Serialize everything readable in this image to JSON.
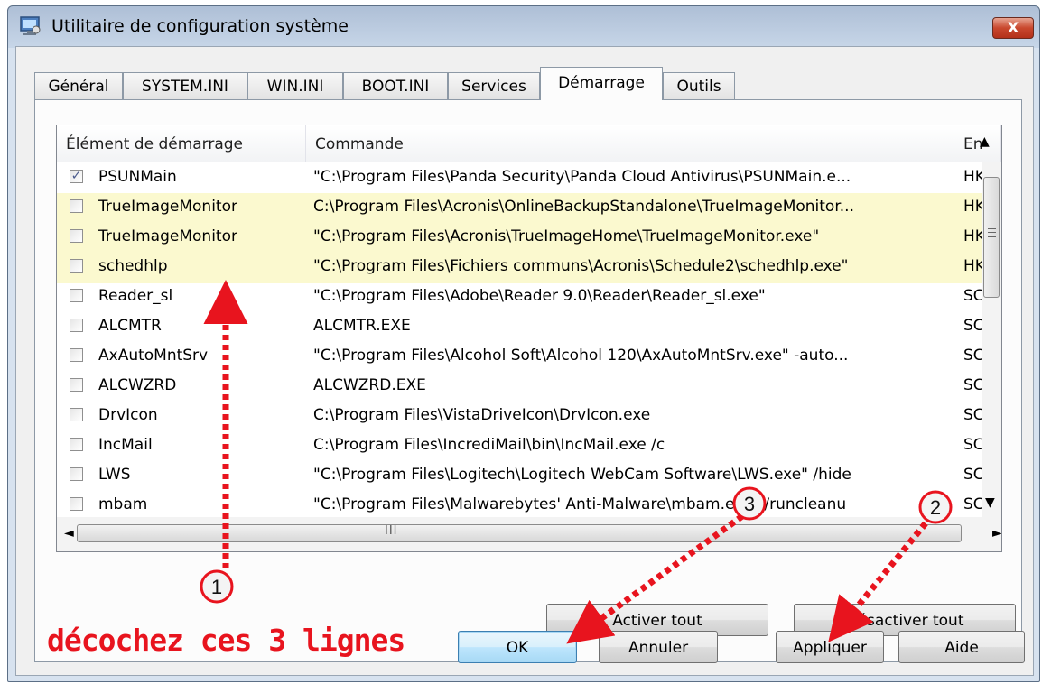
{
  "window": {
    "title": "Utilitaire de configuration système",
    "close_label": "X"
  },
  "tabs": [
    {
      "label": "Général"
    },
    {
      "label": "SYSTEM.INI"
    },
    {
      "label": "WIN.INI"
    },
    {
      "label": "BOOT.INI"
    },
    {
      "label": "Services"
    },
    {
      "label": "Démarrage",
      "active": true
    },
    {
      "label": "Outils"
    }
  ],
  "list": {
    "columns": [
      "Élément de démarrage",
      "Commande",
      "En"
    ],
    "rows": [
      {
        "name": "PSUNMain",
        "command": "\"C:\\Program Files\\Panda Security\\Panda Cloud Antivirus\\PSUNMain.e...",
        "location": "HK",
        "checked": true,
        "highlight": false
      },
      {
        "name": "TrueImageMonitor",
        "command": "C:\\Program Files\\Acronis\\OnlineBackupStandalone\\TrueImageMonitor...",
        "location": "HK",
        "checked": false,
        "highlight": true
      },
      {
        "name": "TrueImageMonitor",
        "command": "\"C:\\Program Files\\Acronis\\TrueImageHome\\TrueImageMonitor.exe\"",
        "location": "HK",
        "checked": false,
        "highlight": true
      },
      {
        "name": "schedhlp",
        "command": "\"C:\\Program Files\\Fichiers communs\\Acronis\\Schedule2\\schedhlp.exe\"",
        "location": "HK",
        "checked": false,
        "highlight": true
      },
      {
        "name": "Reader_sl",
        "command": "\"C:\\Program Files\\Adobe\\Reader 9.0\\Reader\\Reader_sl.exe\"",
        "location": "SC",
        "checked": false,
        "highlight": false
      },
      {
        "name": "ALCMTR",
        "command": "ALCMTR.EXE",
        "location": "SC",
        "checked": false,
        "highlight": false
      },
      {
        "name": "AxAutoMntSrv",
        "command": "\"C:\\Program Files\\Alcohol Soft\\Alcohol 120\\AxAutoMntSrv.exe\" -auto...",
        "location": "SC",
        "checked": false,
        "highlight": false
      },
      {
        "name": "ALCWZRD",
        "command": "ALCWZRD.EXE",
        "location": "SC",
        "checked": false,
        "highlight": false
      },
      {
        "name": "DrvIcon",
        "command": "C:\\Program Files\\VistaDriveIcon\\DrvIcon.exe",
        "location": "SC",
        "checked": false,
        "highlight": false
      },
      {
        "name": "IncMail",
        "command": "C:\\Program Files\\IncrediMail\\bin\\IncMail.exe /c",
        "location": "SC",
        "checked": false,
        "highlight": false
      },
      {
        "name": "LWS",
        "command": "\"C:\\Program Files\\Logitech\\Logitech WebCam Software\\LWS.exe\" /hide",
        "location": "SC",
        "checked": false,
        "highlight": false
      },
      {
        "name": "mbam",
        "command": "\"C:\\Program Files\\Malwarebytes' Anti-Malware\\mbam.exe\" /runcleanu",
        "location": "SC",
        "checked": false,
        "highlight": false
      }
    ],
    "hscroll_grip": "III"
  },
  "buttons": {
    "enable_all": "Activer tout",
    "disable_all": "Désactiver tout",
    "ok": "OK",
    "cancel": "Annuler",
    "apply": "Appliquer",
    "help": "Aide"
  },
  "annotations": {
    "note": "décochez ces 3 lignes",
    "markers": [
      "1",
      "2",
      "3"
    ],
    "color": "#e8141e"
  },
  "colors": {
    "highlight_row": "#fbf9cf",
    "title_bar": "#c7d6e8",
    "close_button": "#c9482e"
  },
  "icons": {
    "window": "msconfig-icon",
    "close": "close-icon",
    "check": "checkmark-icon"
  }
}
